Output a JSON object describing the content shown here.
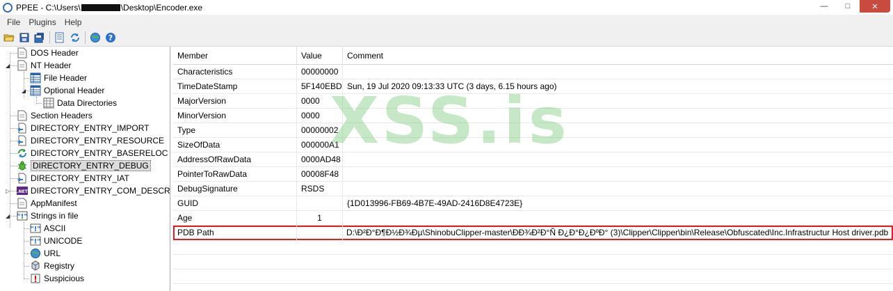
{
  "window": {
    "title_prefix": "PPEE - C:\\Users\\",
    "title_suffix": "\\Desktop\\Encoder.exe",
    "minimize": "—",
    "maximize": "□",
    "close": "✕"
  },
  "menu": [
    "File",
    "Plugins",
    "Help"
  ],
  "toolbar": [
    "open-icon",
    "save-icon",
    "save-all-icon",
    "hex-icon",
    "refresh-icon",
    "globe-icon",
    "help-icon"
  ],
  "tree": [
    {
      "label": "DOS Header",
      "icon": "doc-icon"
    },
    {
      "label": "NT Header",
      "icon": "doc-icon"
    },
    {
      "label": "File Header",
      "icon": "table-icon"
    },
    {
      "label": "Optional Header",
      "icon": "table-icon"
    },
    {
      "label": "Data Directories",
      "icon": "grid-icon"
    },
    {
      "label": "Section Headers",
      "icon": "doc-icon"
    },
    {
      "label": "DIRECTORY_ENTRY_IMPORT",
      "icon": "import-icon"
    },
    {
      "label": "DIRECTORY_ENTRY_RESOURCE",
      "icon": "import-icon"
    },
    {
      "label": "DIRECTORY_ENTRY_BASERELOC",
      "icon": "reloc-icon"
    },
    {
      "label": "DIRECTORY_ENTRY_DEBUG",
      "icon": "bug-icon"
    },
    {
      "label": "DIRECTORY_ENTRY_IAT",
      "icon": "import-icon"
    },
    {
      "label": "DIRECTORY_ENTRY_COM_DESCRIPTO",
      "icon": "net-icon"
    },
    {
      "label": "AppManifest",
      "icon": "doc-icon"
    },
    {
      "label": "Strings in file",
      "icon": "quote-icon"
    },
    {
      "label": "ASCII",
      "icon": "quote-icon"
    },
    {
      "label": "UNICODE",
      "icon": "quote-icon"
    },
    {
      "label": "URL",
      "icon": "globe-icon"
    },
    {
      "label": "Registry",
      "icon": "registry-icon"
    },
    {
      "label": "Suspicious",
      "icon": "warning-icon"
    }
  ],
  "grid": {
    "headers": [
      "Member",
      "Value",
      "Comment"
    ],
    "rows": [
      [
        "Characteristics",
        "00000000",
        ""
      ],
      [
        "TimeDateStamp",
        "5F140EBD",
        "Sun, 19 Jul 2020 09:13:33 UTC (3 days, 6.15 hours ago)"
      ],
      [
        "MajorVersion",
        "0000",
        ""
      ],
      [
        "MinorVersion",
        "0000",
        ""
      ],
      [
        "Type",
        "00000002",
        ""
      ],
      [
        "SizeOfData",
        "000000A1",
        ""
      ],
      [
        "AddressOfRawData",
        "0000AD48",
        ""
      ],
      [
        "PointerToRawData",
        "00008F48",
        ""
      ],
      [
        "DebugSignature",
        "RSDS",
        ""
      ],
      [
        "GUID",
        "",
        "{1D013996-FB69-4B7E-49AD-2416D8E4723E}"
      ],
      [
        "Age",
        "1",
        ""
      ],
      [
        "PDB Path",
        "",
        "D:\\Ð²Ð°Ð¶Ð½Ð¾Ðµ\\ShinobuClipper-master\\ÐÐ¾Ð²Ð°Ñ Ð¿Ð°Ð¿ÐºÐ° (3)\\Clipper\\Clipper\\bin\\Release\\Obfuscated\\Inc.Infrastructur Host driver.pdb"
      ]
    ]
  },
  "watermark": "XSS.is",
  "colors": {
    "highlight": "#e31b23",
    "watermark": "#78c878",
    "selected": "#dcdcdc"
  }
}
